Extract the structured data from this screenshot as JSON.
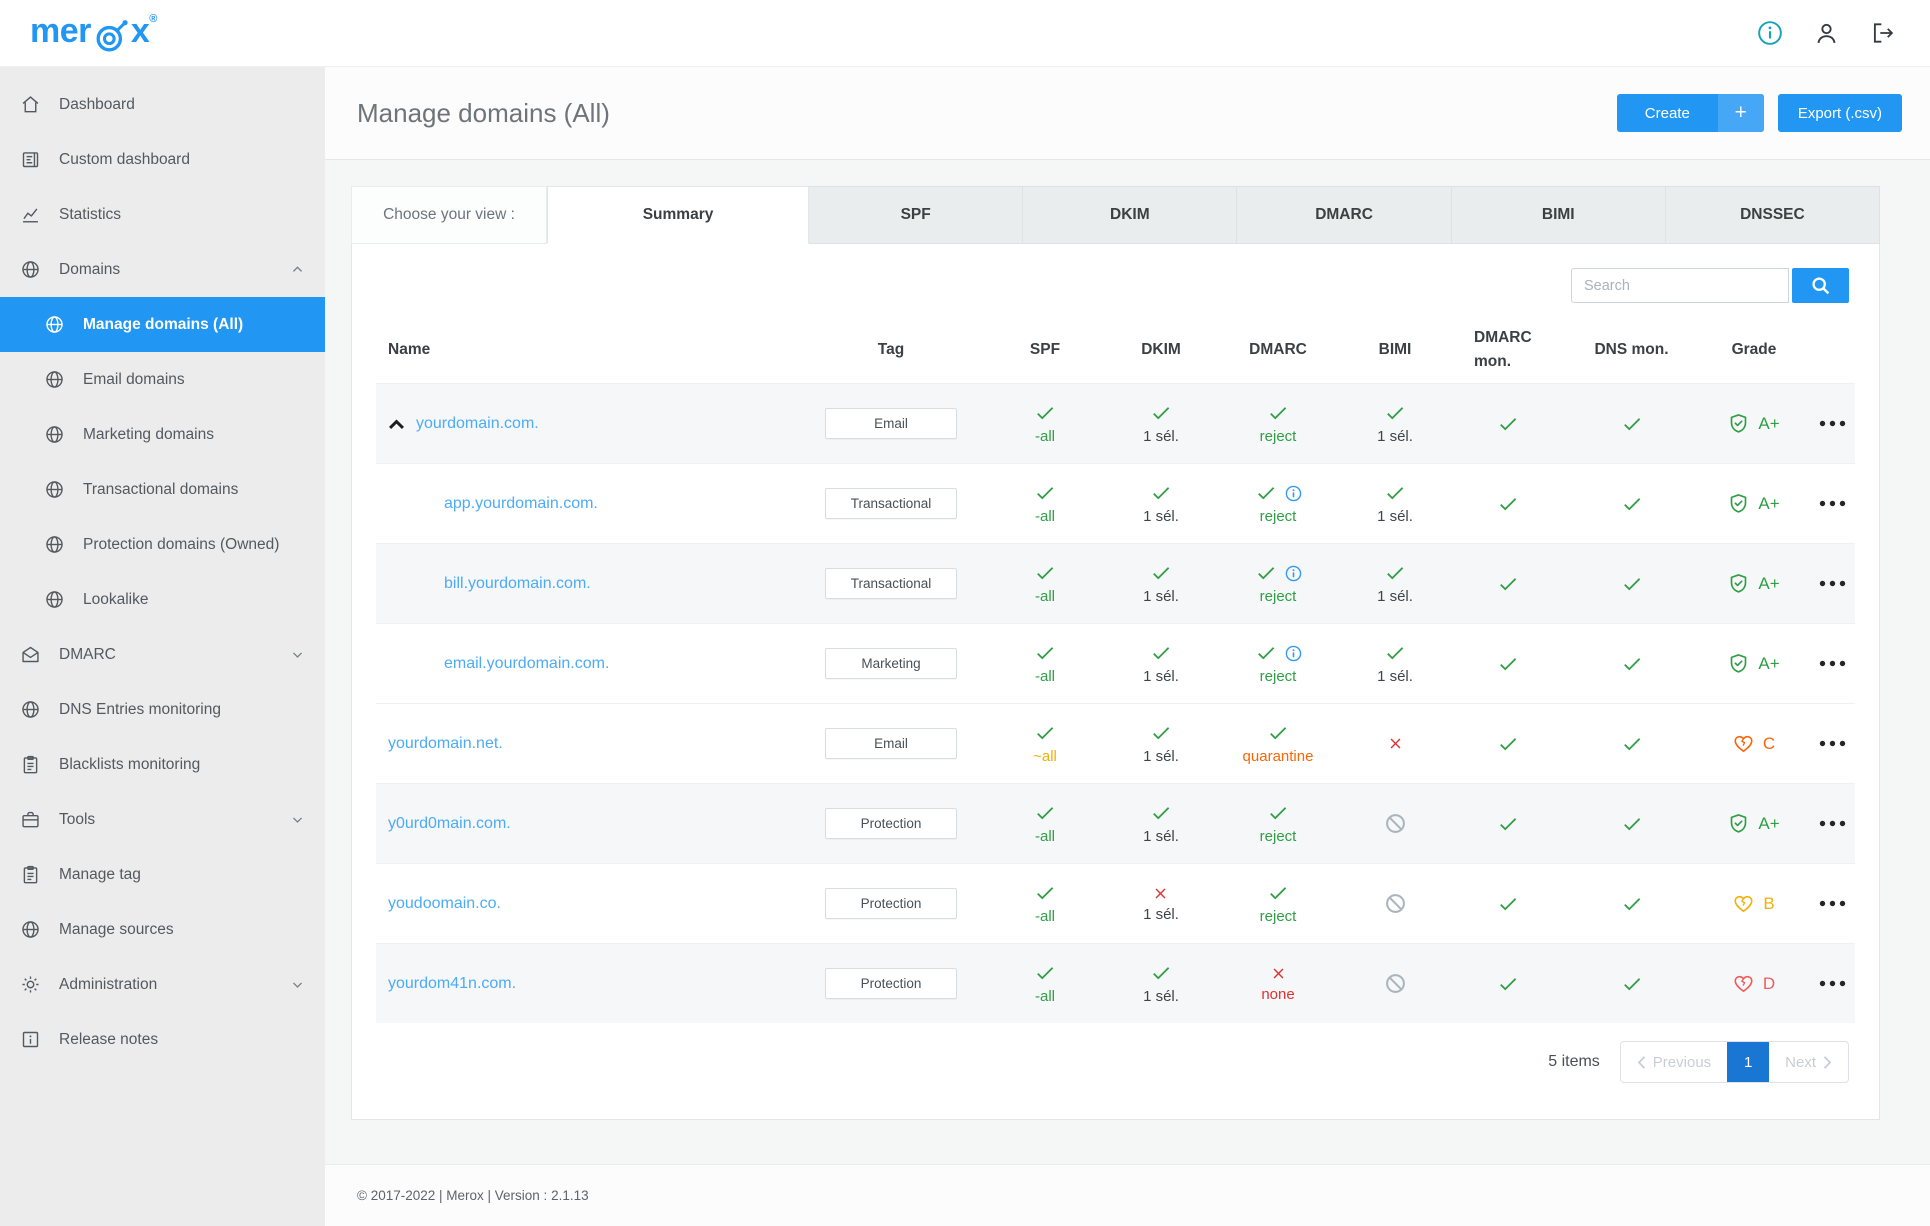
{
  "brand": {
    "logo_pre": "mer",
    "logo_post": "x",
    "trademark": "®"
  },
  "colors": {
    "accent": "#2196f3",
    "accent_light": "#45a7f5",
    "link": "#4dabf7",
    "green": "#2f9e44",
    "red": "#e03131",
    "red_soft": "#f05c5c",
    "orange": "#f76707",
    "yellow": "#f2b008",
    "info": "#339af0",
    "muted": "#a9b4bc",
    "dark": "#3f4448",
    "pager_active": "#1976d2",
    "info_topbar": "#17a2b8",
    "icon_dark": "#343a40"
  },
  "sidebar": {
    "items": [
      {
        "label": "Dashboard",
        "icon": "home"
      },
      {
        "label": "Custom dashboard",
        "icon": "custom-dashboard"
      },
      {
        "label": "Statistics",
        "icon": "statistics"
      },
      {
        "label": "Domains",
        "icon": "globe",
        "chevron": "up"
      },
      {
        "label": "Manage domains (All)",
        "icon": "globe",
        "child": true,
        "active": true
      },
      {
        "label": "Email domains",
        "icon": "globe",
        "child": true
      },
      {
        "label": "Marketing domains",
        "icon": "globe",
        "child": true
      },
      {
        "label": "Transactional domains",
        "icon": "globe",
        "child": true
      },
      {
        "label": "Protection domains (Owned)",
        "icon": "globe",
        "child": true
      },
      {
        "label": "Lookalike",
        "icon": "globe",
        "child": true
      },
      {
        "label": "DMARC",
        "icon": "envelope",
        "chevron": "down"
      },
      {
        "label": "DNS Entries monitoring",
        "icon": "globe"
      },
      {
        "label": "Blacklists monitoring",
        "icon": "clipboard"
      },
      {
        "label": "Tools",
        "icon": "briefcase",
        "chevron": "down"
      },
      {
        "label": "Manage tag",
        "icon": "clipboard"
      },
      {
        "label": "Manage sources",
        "icon": "globe"
      },
      {
        "label": "Administration",
        "icon": "gear",
        "chevron": "down"
      },
      {
        "label": "Release notes",
        "icon": "release-notes"
      }
    ]
  },
  "header": {
    "title": "Manage domains (All)",
    "create_label": "Create",
    "create_plus": "+",
    "export_label": "Export (.csv)"
  },
  "view_tabs": {
    "label": "Choose your view :",
    "tabs": [
      {
        "label": "Summary",
        "active": true
      },
      {
        "label": "SPF"
      },
      {
        "label": "DKIM"
      },
      {
        "label": "DMARC"
      },
      {
        "label": "BIMI"
      },
      {
        "label": "DNSSEC"
      }
    ]
  },
  "search": {
    "placeholder": "Search"
  },
  "table": {
    "columns": [
      "Name",
      "Tag",
      "SPF",
      "DKIM",
      "DMARC",
      "BIMI",
      "DMARC mon.",
      "DNS mon.",
      "Grade"
    ],
    "rows": [
      {
        "name": "yourdomain.com.",
        "expanded": true,
        "tag": "Email",
        "spf": {
          "status": "check",
          "text": "-all",
          "color": "green"
        },
        "dkim": {
          "status": "check",
          "text": "1 sél.",
          "color": "dark"
        },
        "dmarc": {
          "status": "check",
          "text": "reject",
          "color": "green"
        },
        "bimi": {
          "status": "check",
          "text": "1 sél.",
          "color": "dark"
        },
        "dmarc_mon": {
          "status": "check"
        },
        "dns_mon": {
          "status": "check"
        },
        "grade": {
          "value": "A+",
          "icon": "shield",
          "color": "green"
        }
      },
      {
        "name": "app.yourdomain.com.",
        "child": true,
        "tag": "Transactional",
        "spf": {
          "status": "check",
          "text": "-all",
          "color": "green"
        },
        "dkim": {
          "status": "check",
          "text": "1 sél.",
          "color": "dark"
        },
        "dmarc": {
          "status": "check",
          "info": true,
          "text": "reject",
          "color": "green"
        },
        "bimi": {
          "status": "check",
          "text": "1 sél.",
          "color": "dark"
        },
        "dmarc_mon": {
          "status": "check"
        },
        "dns_mon": {
          "status": "check"
        },
        "grade": {
          "value": "A+",
          "icon": "shield",
          "color": "green"
        }
      },
      {
        "name": "bill.yourdomain.com.",
        "child": true,
        "tag": "Transactional",
        "spf": {
          "status": "check",
          "text": "-all",
          "color": "green"
        },
        "dkim": {
          "status": "check",
          "text": "1 sél.",
          "color": "dark"
        },
        "dmarc": {
          "status": "check",
          "info": true,
          "text": "reject",
          "color": "green"
        },
        "bimi": {
          "status": "check",
          "text": "1 sél.",
          "color": "dark"
        },
        "dmarc_mon": {
          "status": "check"
        },
        "dns_mon": {
          "status": "check"
        },
        "grade": {
          "value": "A+",
          "icon": "shield",
          "color": "green"
        }
      },
      {
        "name": "email.yourdomain.com.",
        "child": true,
        "tag": "Marketing",
        "spf": {
          "status": "check",
          "text": "-all",
          "color": "green"
        },
        "dkim": {
          "status": "check",
          "text": "1 sél.",
          "color": "dark"
        },
        "dmarc": {
          "status": "check",
          "info": true,
          "text": "reject",
          "color": "green"
        },
        "bimi": {
          "status": "check",
          "text": "1 sél.",
          "color": "dark"
        },
        "dmarc_mon": {
          "status": "check"
        },
        "dns_mon": {
          "status": "check"
        },
        "grade": {
          "value": "A+",
          "icon": "shield",
          "color": "green"
        }
      },
      {
        "name": "yourdomain.net.",
        "tag": "Email",
        "spf": {
          "status": "check",
          "text": "~all",
          "color": "yellow"
        },
        "dkim": {
          "status": "check",
          "text": "1 sél.",
          "color": "dark"
        },
        "dmarc": {
          "status": "check",
          "text": "quarantine",
          "color": "orange"
        },
        "bimi": {
          "status": "cross"
        },
        "dmarc_mon": {
          "status": "check"
        },
        "dns_mon": {
          "status": "check"
        },
        "grade": {
          "value": "C",
          "icon": "heart",
          "color": "orange"
        }
      },
      {
        "name": "y0urd0main.com.",
        "tag": "Protection",
        "spf": {
          "status": "check",
          "text": "-all",
          "color": "green"
        },
        "dkim": {
          "status": "check",
          "text": "1 sél.",
          "color": "dark"
        },
        "dmarc": {
          "status": "check",
          "text": "reject",
          "color": "green"
        },
        "bimi": {
          "status": "blocked"
        },
        "dmarc_mon": {
          "status": "check"
        },
        "dns_mon": {
          "status": "check"
        },
        "grade": {
          "value": "A+",
          "icon": "shield",
          "color": "green"
        }
      },
      {
        "name": "youdoomain.co.",
        "tag": "Protection",
        "spf": {
          "status": "check",
          "text": "-all",
          "color": "green"
        },
        "dkim": {
          "status": "cross",
          "text": "1 sél.",
          "color": "dark"
        },
        "dmarc": {
          "status": "check",
          "text": "reject",
          "color": "green"
        },
        "bimi": {
          "status": "blocked"
        },
        "dmarc_mon": {
          "status": "check"
        },
        "dns_mon": {
          "status": "check"
        },
        "grade": {
          "value": "B",
          "icon": "heart",
          "color": "yellow"
        }
      },
      {
        "name": "yourdom41n.com.",
        "tag": "Protection",
        "spf": {
          "status": "check",
          "text": "-all",
          "color": "green"
        },
        "dkim": {
          "status": "check",
          "text": "1 sél.",
          "color": "dark"
        },
        "dmarc": {
          "status": "cross",
          "text": "none",
          "color": "red"
        },
        "bimi": {
          "status": "blocked"
        },
        "dmarc_mon": {
          "status": "check"
        },
        "dns_mon": {
          "status": "check"
        },
        "grade": {
          "value": "D",
          "icon": "heart",
          "color": "red_soft"
        }
      }
    ]
  },
  "pagination": {
    "items_text": "5 items",
    "previous": "Previous",
    "page": "1",
    "next": "Next"
  },
  "footer": {
    "text": "© 2017-2022 | Merox | Version : 2.1.13"
  }
}
